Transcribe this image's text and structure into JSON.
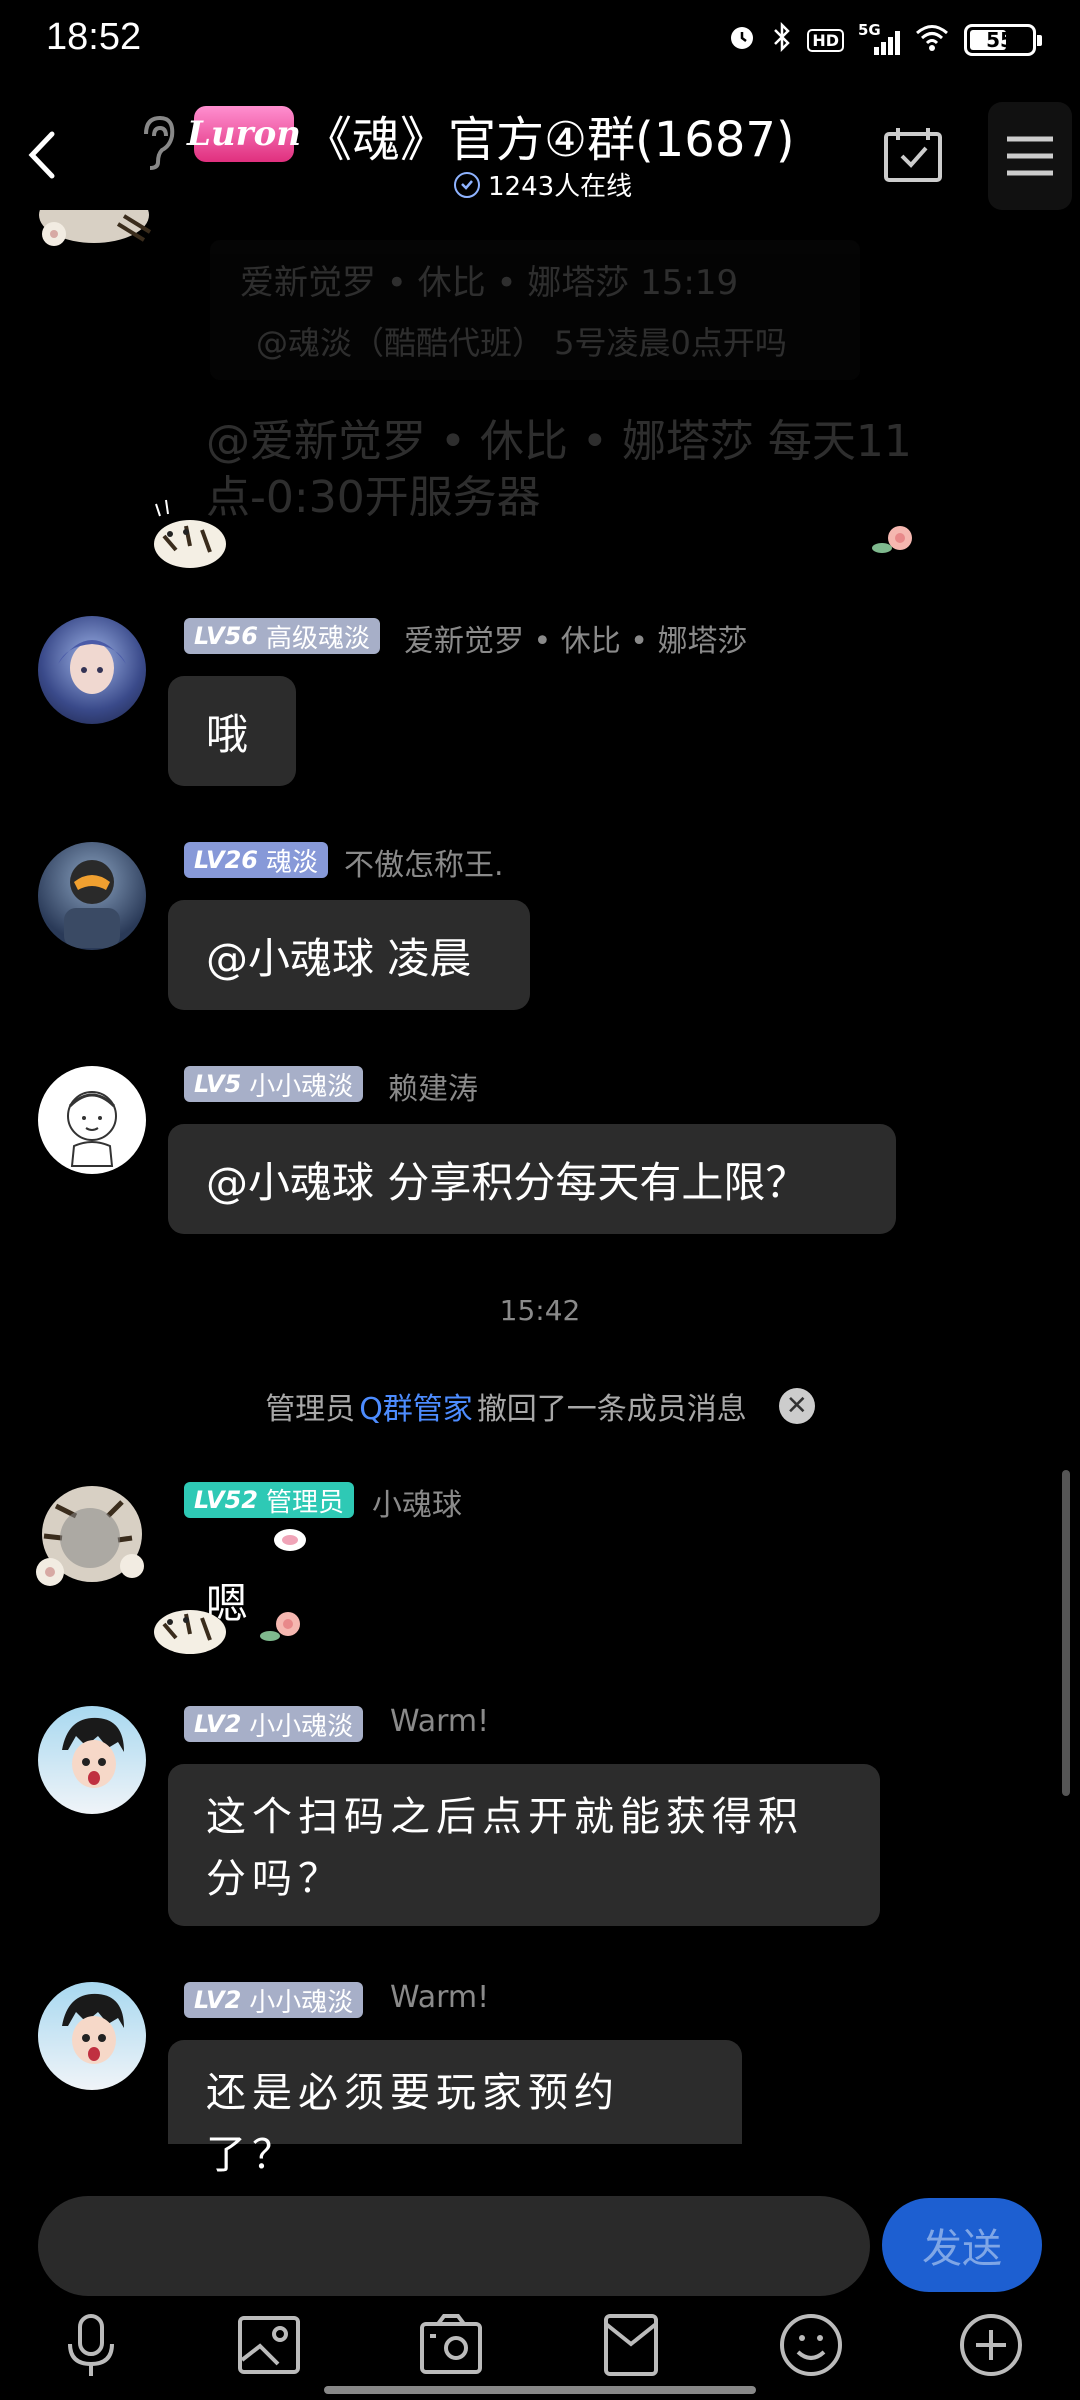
{
  "status_bar": {
    "time": "18:52",
    "signal_label": "5G",
    "hd_label": "HD",
    "battery": "55"
  },
  "header": {
    "logo_text": "Luron",
    "title": "《魂》官方④群(1687)",
    "online": "1243人在线"
  },
  "faded": {
    "sender": "爱新觉罗 • 休比 • 娜塔莎  15:19",
    "quote": "@魂淡（酷酷代班） 5号凌晨0点开吗",
    "message": "@爱新觉罗 • 休比 • 娜塔莎  每天11点-0:30开服务器"
  },
  "messages": [
    {
      "level": "LV56",
      "title": "高级魂淡",
      "nick": "爱新觉罗 • 休比 • 娜塔莎",
      "text": "哦",
      "badge_color": "#a7afc8"
    },
    {
      "level": "LV26",
      "title": "魂淡",
      "nick": "不傲怎称王.",
      "text": "@小魂球  凌晨",
      "badge_color": "#8799d8"
    },
    {
      "level": "LV5",
      "title": "小小魂淡",
      "nick": "赖建涛",
      "text": "@小魂球  分享积分每天有上限？",
      "badge_color": "#a7afc8"
    },
    {
      "level": "LV52",
      "title": "管理员",
      "nick": "小魂球",
      "text": "嗯",
      "badge_color": "#2ec9b5"
    },
    {
      "level": "LV2",
      "title": "小小魂淡",
      "nick": "Warm!",
      "text": "这个扫码之后点开就能获得积分吗？",
      "badge_color": "#a7afc8"
    },
    {
      "level": "LV2",
      "title": "小小魂淡",
      "nick": "Warm!",
      "text": "还是必须要玩家预约了？",
      "badge_color": "#a7afc8"
    }
  ],
  "time_divider": "15:42",
  "recall_notice": {
    "prefix": "管理员",
    "link": "Q群管家",
    "suffix": "撤回了一条成员消息"
  },
  "input": {
    "placeholder": "",
    "send_label": "发送"
  },
  "colors": {
    "accent": "#1d5fd1",
    "link": "#4d8cff",
    "admin_badge": "#2ec9b5"
  }
}
